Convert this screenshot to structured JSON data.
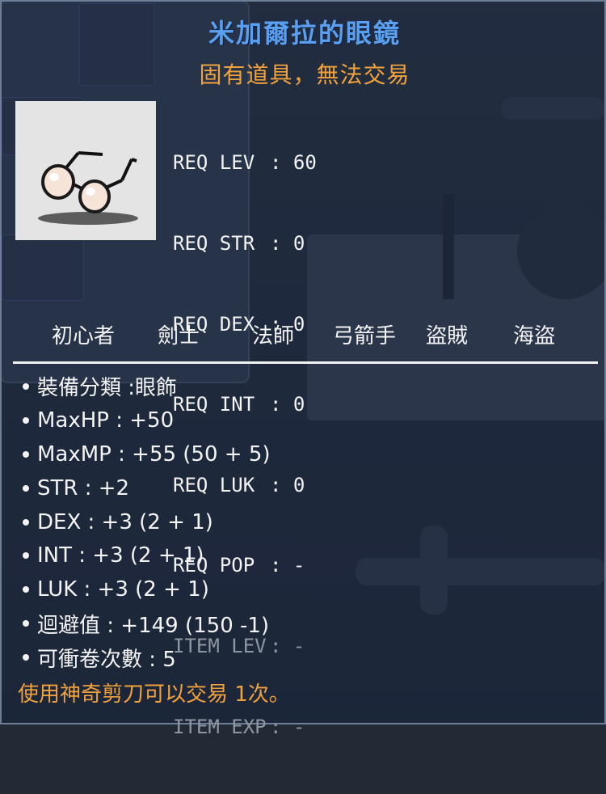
{
  "item": {
    "name": "米加爾拉的眼鏡",
    "subtitle": "固有道具，無法交易",
    "icon": "glasses-icon"
  },
  "requirements": [
    {
      "label": "REQ LEV",
      "value": "60",
      "dim": false
    },
    {
      "label": "REQ STR",
      "value": "0",
      "dim": false
    },
    {
      "label": "REQ DEX",
      "value": "0",
      "dim": false
    },
    {
      "label": "REQ INT",
      "value": "0",
      "dim": false
    },
    {
      "label": "REQ LUK",
      "value": "0",
      "dim": false
    },
    {
      "label": "REQ POP",
      "value": "-",
      "dim": false
    },
    {
      "label": "ITEM LEV",
      "value": "-",
      "dim": true
    },
    {
      "label": "ITEM EXP",
      "value": "-",
      "dim": true
    }
  ],
  "jobs": [
    "初心者",
    "劍士",
    "法師",
    "弓箭手",
    "盜賊",
    "海盜"
  ],
  "stats": [
    "裝備分類 :眼飾",
    "MaxHP : +50",
    "MaxMP : +55 (50 + 5)",
    "STR : +2",
    "DEX : +3 (2 + 1)",
    "INT : +3 (2 + 1)",
    "LUK : +3 (2 + 1)",
    "迴避值 : +149 (150 -1)",
    "可衝卷次數 : 5"
  ],
  "trade_note": "使用神奇剪刀可以交易 1次。",
  "colors": {
    "title": "#5b9ff0",
    "subtitle": "#f2a23a",
    "text": "#f4f4f4",
    "dim_text": "#8e96a0",
    "overlay": "#121c30"
  }
}
